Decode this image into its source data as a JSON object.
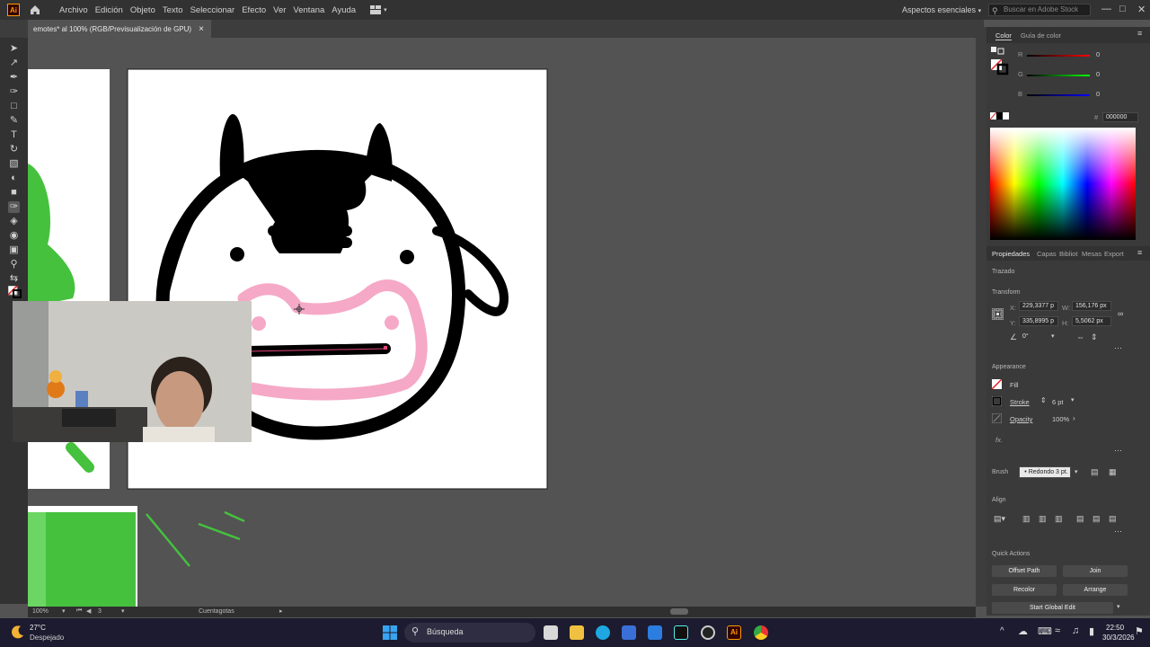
{
  "app": {
    "logo": "Ai"
  },
  "menu": [
    "Archivo",
    "Edición",
    "Objeto",
    "Texto",
    "Seleccionar",
    "Efecto",
    "Ver",
    "Ventana",
    "Ayuda"
  ],
  "workspace": "Aspectos esenciales",
  "stock_search_placeholder": "Buscar en Adobe Stock",
  "document_tab": {
    "title": "emotes* al 100% (RGB/Previsualización de GPU)",
    "close": "×"
  },
  "color_panel": {
    "tabs": [
      "Color",
      "Guía de color"
    ],
    "channels": [
      {
        "label": "R",
        "value": "0"
      },
      {
        "label": "G",
        "value": "0"
      },
      {
        "label": "B",
        "value": "0"
      }
    ],
    "hex_prefix": "#",
    "hex": "000000"
  },
  "properties_panel": {
    "tabs": [
      "Propiedades",
      "Capas",
      "Bibliot",
      "Mesas",
      "Export"
    ],
    "object_type": "Trazado",
    "transform": {
      "title": "Transform",
      "x_label": "X:",
      "x": "229,3377 p",
      "y_label": "Y:",
      "y": "335,8995 p",
      "w_label": "W:",
      "w": "156,176 px",
      "h_label": "H:",
      "h": "5,5062 px",
      "angle": "0°"
    },
    "appearance": {
      "title": "Appearance",
      "fill_label": "Fill",
      "stroke_label": "Stroke",
      "stroke_value": "6 pt",
      "opacity_label": "Opacity",
      "opacity_value": "100%",
      "fx": "fx."
    },
    "brush": {
      "label": "Brush",
      "value": "Redondo 3 pt."
    },
    "align": {
      "title": "Align"
    },
    "quick_actions": {
      "title": "Quick Actions",
      "buttons": [
        "Offset Path",
        "Join",
        "Recolor",
        "Arrange"
      ],
      "global_edit": "Start Global Edit"
    }
  },
  "status_bar": {
    "zoom": "100%",
    "artboard": "3",
    "tool": "Cuentagotas"
  },
  "taskbar": {
    "weather_temp": "27°C",
    "weather_desc": "Despejado",
    "search": "Búsqueda",
    "time": "22:50",
    "date": "30/3/2026"
  },
  "colors": {
    "accent_green": "#45c13e",
    "pink": "#f5a9c6",
    "ui_dark": "#323232",
    "canvas_bg": "#535353",
    "taskbar": "#1c1b2f"
  }
}
